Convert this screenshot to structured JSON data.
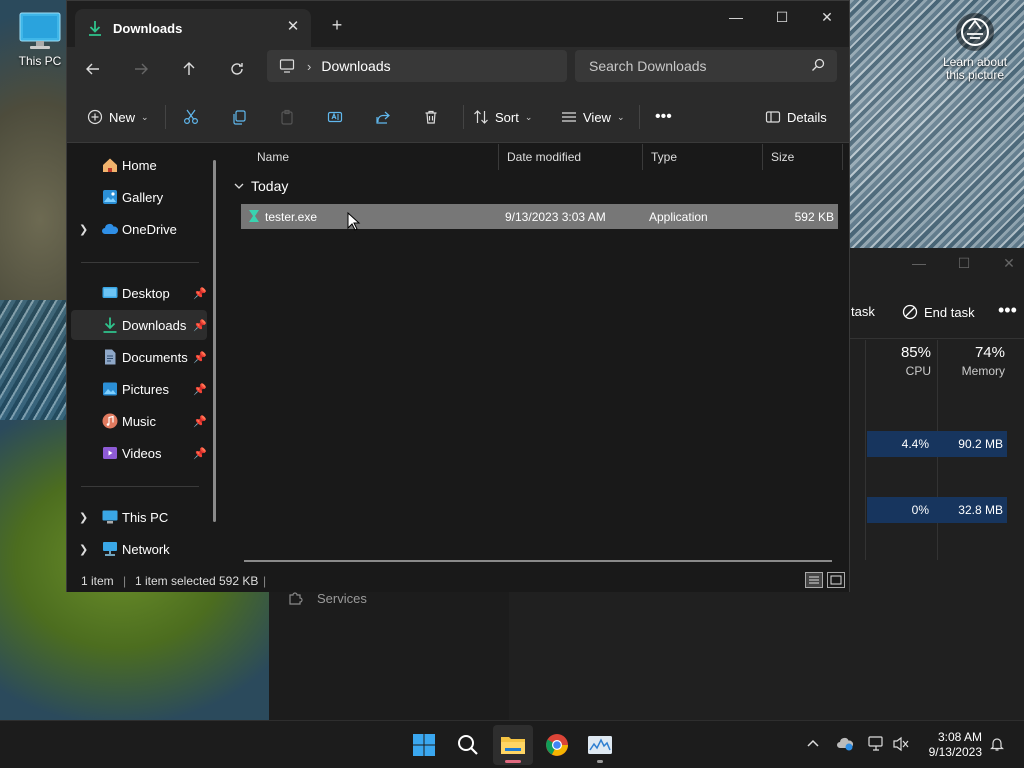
{
  "desktop": {
    "icons": [
      {
        "label": "This PC",
        "icon": "monitor-icon"
      }
    ],
    "learn_picture": {
      "label": "Learn about this picture",
      "icon": "camera-circle-icon"
    }
  },
  "task_manager": {
    "commands": {
      "run_task": "task",
      "end_task": "End task"
    },
    "columns": [
      {
        "percent": "85%",
        "name": "CPU"
      },
      {
        "percent": "74%",
        "name": "Memory"
      }
    ],
    "rows": [
      {
        "cpu": "4.4%",
        "memory": "90.2 MB"
      },
      {
        "cpu": "0%",
        "memory": "32.8 MB"
      }
    ],
    "nav": {
      "services": "Services"
    }
  },
  "explorer": {
    "tab_title": "Downloads",
    "address": {
      "crumb": "Downloads"
    },
    "search": {
      "placeholder": "Search Downloads"
    },
    "toolbar": {
      "new_label": "New",
      "sort_label": "Sort",
      "view_label": "View",
      "details_label": "Details"
    },
    "sidebar": {
      "items": [
        {
          "label": "Home",
          "icon": "home-icon"
        },
        {
          "label": "Gallery",
          "icon": "gallery-icon"
        },
        {
          "label": "OneDrive",
          "icon": "cloud-icon"
        },
        {
          "label": "Desktop",
          "icon": "desktop-icon"
        },
        {
          "label": "Downloads",
          "icon": "download-icon"
        },
        {
          "label": "Documents",
          "icon": "document-icon"
        },
        {
          "label": "Pictures",
          "icon": "pictures-icon"
        },
        {
          "label": "Music",
          "icon": "music-icon"
        },
        {
          "label": "Videos",
          "icon": "video-icon"
        },
        {
          "label": "This PC",
          "icon": "monitor-icon"
        },
        {
          "label": "Network",
          "icon": "network-icon"
        }
      ]
    },
    "columns": {
      "name": "Name",
      "date": "Date modified",
      "type": "Type",
      "size": "Size"
    },
    "group": "Today",
    "files": [
      {
        "name": "tester.exe",
        "date": "9/13/2023 3:03 AM",
        "type": "Application",
        "size": "592 KB"
      }
    ],
    "status": {
      "count": "1 item",
      "selected": "1 item selected",
      "size": "592 KB"
    }
  },
  "taskbar": {
    "clock": {
      "time": "3:08 AM",
      "date": "9/13/2023"
    }
  },
  "colors": {
    "accent": "#0078d4",
    "selection": "#777777",
    "tm_highlight": "#17355e"
  }
}
